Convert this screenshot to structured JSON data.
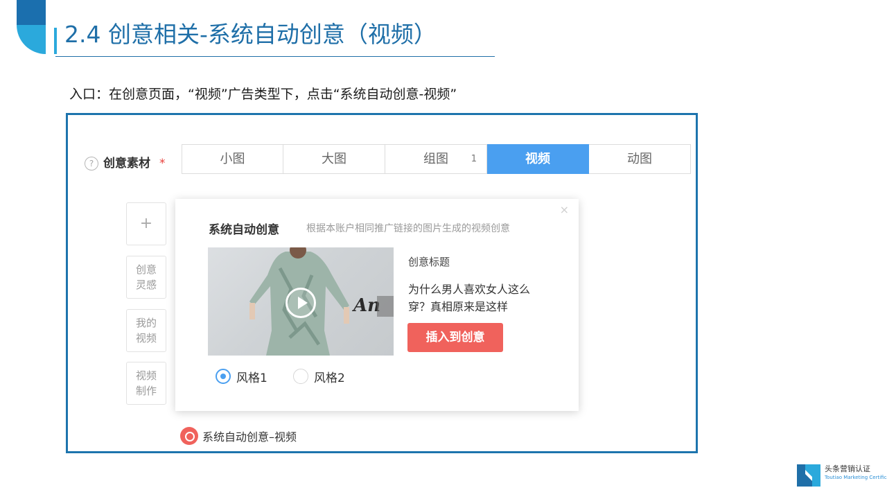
{
  "slide": {
    "title": "2.4 创意相关-系统自动创意（视频）",
    "intro": "入口：在创意页面，“视频”广告类型下，点击“系统自动创意-视频”"
  },
  "form": {
    "help_glyph": "?",
    "label": "创意素材",
    "required_mark": "*",
    "tabs": [
      {
        "label": "小图"
      },
      {
        "label": "大图"
      },
      {
        "label": "组图",
        "count": "1"
      },
      {
        "label": "视频",
        "active": true
      },
      {
        "label": "动图"
      }
    ],
    "side_buttons": [
      "+",
      "创意灵感",
      "我的视频",
      "视频制作"
    ]
  },
  "popover": {
    "close_glyph": "×",
    "title": "系统自动创意",
    "description": "根据本账户相同推广链接的图片生成的视频创意",
    "video_title_label": "创意标题",
    "video_title_text": "为什么男人喜欢女人这么穿？真相原来是这样",
    "insert_button": "插入到创意",
    "styles": [
      {
        "label": "风格1",
        "selected": true
      },
      {
        "label": "风格2",
        "selected": false
      }
    ]
  },
  "auto_creative_link": "系统自动创意–视频",
  "brand": {
    "name": "头条营销认证",
    "subtitle": "Toutiao Marketing Certification"
  },
  "colors": {
    "title_blue": "#1f6fa8",
    "frame_blue": "#1d74ad",
    "tab_active": "#4a9ff0",
    "accent_red": "#f0625c"
  },
  "icons": {
    "help": "help-circle-icon",
    "close": "close-icon",
    "play": "play-icon",
    "auto_creative": "auto-creative-icon",
    "brand": "toutiao-logo-icon"
  }
}
